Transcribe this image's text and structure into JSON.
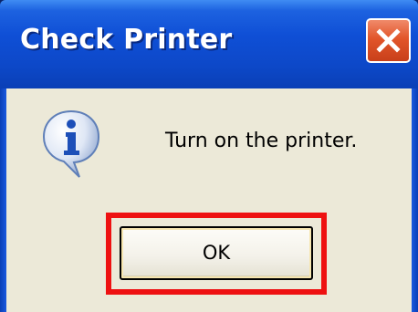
{
  "window": {
    "title": "Check Printer",
    "close_icon": "close-icon"
  },
  "dialog": {
    "icon": "information-icon",
    "message": "Turn on the printer.",
    "ok_label": "OK",
    "highlight_color": "#ee1111"
  },
  "colors": {
    "titlebar": "#0d48c8",
    "client": "#ece9d8",
    "close_button": "#e2552a"
  }
}
